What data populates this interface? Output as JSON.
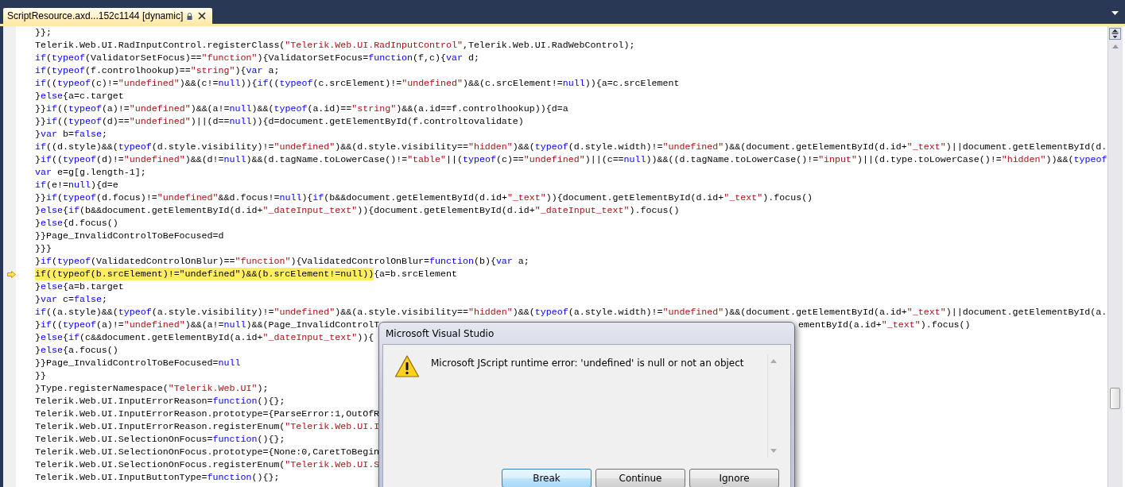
{
  "tab": {
    "label": "ScriptResource.axd...152c1144 [dynamic]",
    "selected": true
  },
  "editor": {
    "lines": [
      {
        "current": false,
        "segs": [
          {
            "kind": "plain",
            "text": "}};"
          }
        ]
      },
      {
        "current": false,
        "segs": [
          {
            "kind": "plain",
            "text": "Telerik.Web.UI.RadInputControl.registerClass("
          },
          {
            "kind": "string",
            "text": "\"Telerik.Web.UI.RadInputControl\""
          },
          {
            "kind": "plain",
            "text": ",Telerik.Web.UI.RadWebControl);"
          }
        ]
      },
      {
        "current": false,
        "segs": [
          {
            "kind": "keyword",
            "text": "if"
          },
          {
            "kind": "plain",
            "text": "("
          },
          {
            "kind": "keyword",
            "text": "typeof"
          },
          {
            "kind": "plain",
            "text": "(ValidatorSetFocus)=="
          },
          {
            "kind": "string",
            "text": "\"function\""
          },
          {
            "kind": "plain",
            "text": "){ValidatorSetFocus="
          },
          {
            "kind": "keyword",
            "text": "function"
          },
          {
            "kind": "plain",
            "text": "(f,c){"
          },
          {
            "kind": "keyword",
            "text": "var"
          },
          {
            "kind": "plain",
            "text": " d;"
          }
        ]
      },
      {
        "current": false,
        "segs": [
          {
            "kind": "keyword",
            "text": "if"
          },
          {
            "kind": "plain",
            "text": "("
          },
          {
            "kind": "keyword",
            "text": "typeof"
          },
          {
            "kind": "plain",
            "text": "(f.controlhookup)=="
          },
          {
            "kind": "string",
            "text": "\"string\""
          },
          {
            "kind": "plain",
            "text": "){"
          },
          {
            "kind": "keyword",
            "text": "var"
          },
          {
            "kind": "plain",
            "text": " a;"
          }
        ]
      },
      {
        "current": false,
        "segs": [
          {
            "kind": "keyword",
            "text": "if"
          },
          {
            "kind": "plain",
            "text": "(("
          },
          {
            "kind": "keyword",
            "text": "typeof"
          },
          {
            "kind": "plain",
            "text": "(c)!="
          },
          {
            "kind": "string",
            "text": "\"undefined\""
          },
          {
            "kind": "plain",
            "text": ")&&(c!="
          },
          {
            "kind": "keyword",
            "text": "null"
          },
          {
            "kind": "plain",
            "text": ")){"
          },
          {
            "kind": "keyword",
            "text": "if"
          },
          {
            "kind": "plain",
            "text": "(("
          },
          {
            "kind": "keyword",
            "text": "typeof"
          },
          {
            "kind": "plain",
            "text": "(c.srcElement)!="
          },
          {
            "kind": "string",
            "text": "\"undefined\""
          },
          {
            "kind": "plain",
            "text": ")&&(c.srcElement!="
          },
          {
            "kind": "keyword",
            "text": "null"
          },
          {
            "kind": "plain",
            "text": ")){a=c.srcElement"
          }
        ]
      },
      {
        "current": false,
        "segs": [
          {
            "kind": "plain",
            "text": "}"
          },
          {
            "kind": "keyword",
            "text": "else"
          },
          {
            "kind": "plain",
            "text": "{a=c.target"
          }
        ]
      },
      {
        "current": false,
        "segs": [
          {
            "kind": "plain",
            "text": "}}"
          },
          {
            "kind": "keyword",
            "text": "if"
          },
          {
            "kind": "plain",
            "text": "(("
          },
          {
            "kind": "keyword",
            "text": "typeof"
          },
          {
            "kind": "plain",
            "text": "(a)!="
          },
          {
            "kind": "string",
            "text": "\"undefined\""
          },
          {
            "kind": "plain",
            "text": ")&&(a!="
          },
          {
            "kind": "keyword",
            "text": "null"
          },
          {
            "kind": "plain",
            "text": ")&&("
          },
          {
            "kind": "keyword",
            "text": "typeof"
          },
          {
            "kind": "plain",
            "text": "(a.id)=="
          },
          {
            "kind": "string",
            "text": "\"string\""
          },
          {
            "kind": "plain",
            "text": ")&&(a.id==f.controlhookup)){d=a"
          }
        ]
      },
      {
        "current": false,
        "segs": [
          {
            "kind": "plain",
            "text": "}}"
          },
          {
            "kind": "keyword",
            "text": "if"
          },
          {
            "kind": "plain",
            "text": "(("
          },
          {
            "kind": "keyword",
            "text": "typeof"
          },
          {
            "kind": "plain",
            "text": "(d)=="
          },
          {
            "kind": "string",
            "text": "\"undefined\""
          },
          {
            "kind": "plain",
            "text": ")||(d=="
          },
          {
            "kind": "keyword",
            "text": "null"
          },
          {
            "kind": "plain",
            "text": ")){d=document.getElementById(f.controltovalidate)"
          }
        ]
      },
      {
        "current": false,
        "segs": [
          {
            "kind": "plain",
            "text": "}"
          },
          {
            "kind": "keyword",
            "text": "var"
          },
          {
            "kind": "plain",
            "text": " b="
          },
          {
            "kind": "keyword",
            "text": "false"
          },
          {
            "kind": "plain",
            "text": ";"
          }
        ]
      },
      {
        "current": false,
        "segs": [
          {
            "kind": "keyword",
            "text": "if"
          },
          {
            "kind": "plain",
            "text": "((d.style)&&("
          },
          {
            "kind": "keyword",
            "text": "typeof"
          },
          {
            "kind": "plain",
            "text": "(d.style.visibility)!="
          },
          {
            "kind": "string",
            "text": "\"undefined\""
          },
          {
            "kind": "plain",
            "text": ")&&(d.style.visibility=="
          },
          {
            "kind": "string",
            "text": "\"hidden\""
          },
          {
            "kind": "plain",
            "text": ")&&("
          },
          {
            "kind": "keyword",
            "text": "typeof"
          },
          {
            "kind": "plain",
            "text": "(d.style.width)!="
          },
          {
            "kind": "string",
            "text": "\"undefined\""
          },
          {
            "kind": "plain",
            "text": ")&&(document.getElementById(d.id+"
          },
          {
            "kind": "string",
            "text": "\"_text\""
          },
          {
            "kind": "plain",
            "text": ")||document.getElementById(d."
          }
        ]
      },
      {
        "current": false,
        "segs": [
          {
            "kind": "plain",
            "text": "}"
          },
          {
            "kind": "keyword",
            "text": "if"
          },
          {
            "kind": "plain",
            "text": "(("
          },
          {
            "kind": "keyword",
            "text": "typeof"
          },
          {
            "kind": "plain",
            "text": "(d)!="
          },
          {
            "kind": "string",
            "text": "\"undefined\""
          },
          {
            "kind": "plain",
            "text": ")&&(d!="
          },
          {
            "kind": "keyword",
            "text": "null"
          },
          {
            "kind": "plain",
            "text": ")&&(d.tagName.toLowerCase()!="
          },
          {
            "kind": "string",
            "text": "\"table\""
          },
          {
            "kind": "plain",
            "text": "||("
          },
          {
            "kind": "keyword",
            "text": "typeof"
          },
          {
            "kind": "plain",
            "text": "(c)=="
          },
          {
            "kind": "string",
            "text": "\"undefined\""
          },
          {
            "kind": "plain",
            "text": ")||(c=="
          },
          {
            "kind": "keyword",
            "text": "null"
          },
          {
            "kind": "plain",
            "text": "))&&((d.tagName.toLowerCase()!="
          },
          {
            "kind": "string",
            "text": "\"input\""
          },
          {
            "kind": "plain",
            "text": ")||(d.type.toLowerCase()!="
          },
          {
            "kind": "string",
            "text": "\"hidden\""
          },
          {
            "kind": "plain",
            "text": "))&&("
          },
          {
            "kind": "keyword",
            "text": "typeof"
          }
        ]
      },
      {
        "current": false,
        "segs": [
          {
            "kind": "keyword",
            "text": "var"
          },
          {
            "kind": "plain",
            "text": " e=g[g.length-1];"
          }
        ]
      },
      {
        "current": false,
        "segs": [
          {
            "kind": "keyword",
            "text": "if"
          },
          {
            "kind": "plain",
            "text": "(e!="
          },
          {
            "kind": "keyword",
            "text": "null"
          },
          {
            "kind": "plain",
            "text": "){d=e"
          }
        ]
      },
      {
        "current": false,
        "segs": [
          {
            "kind": "plain",
            "text": "}}"
          },
          {
            "kind": "keyword",
            "text": "if"
          },
          {
            "kind": "plain",
            "text": "("
          },
          {
            "kind": "keyword",
            "text": "typeof"
          },
          {
            "kind": "plain",
            "text": "(d.focus)!="
          },
          {
            "kind": "string",
            "text": "\"undefined\""
          },
          {
            "kind": "plain",
            "text": "&&d.focus!="
          },
          {
            "kind": "keyword",
            "text": "null"
          },
          {
            "kind": "plain",
            "text": "){"
          },
          {
            "kind": "keyword",
            "text": "if"
          },
          {
            "kind": "plain",
            "text": "(b&&document.getElementById(d.id+"
          },
          {
            "kind": "string",
            "text": "\"_text\""
          },
          {
            "kind": "plain",
            "text": ")){document.getElementById(d.id+"
          },
          {
            "kind": "string",
            "text": "\"_text\""
          },
          {
            "kind": "plain",
            "text": ").focus()"
          }
        ]
      },
      {
        "current": false,
        "segs": [
          {
            "kind": "plain",
            "text": "}"
          },
          {
            "kind": "keyword",
            "text": "else"
          },
          {
            "kind": "plain",
            "text": "{"
          },
          {
            "kind": "keyword",
            "text": "if"
          },
          {
            "kind": "plain",
            "text": "(b&&document.getElementById(d.id+"
          },
          {
            "kind": "string",
            "text": "\"_dateInput_text\""
          },
          {
            "kind": "plain",
            "text": ")){document.getElementById(d.id+"
          },
          {
            "kind": "string",
            "text": "\"_dateInput_text\""
          },
          {
            "kind": "plain",
            "text": ").focus()"
          }
        ]
      },
      {
        "current": false,
        "segs": [
          {
            "kind": "plain",
            "text": "}"
          },
          {
            "kind": "keyword",
            "text": "else"
          },
          {
            "kind": "plain",
            "text": "{d.focus()"
          }
        ]
      },
      {
        "current": false,
        "segs": [
          {
            "kind": "plain",
            "text": "}}Page_InvalidControlToBeFocused=d"
          }
        ]
      },
      {
        "current": false,
        "segs": [
          {
            "kind": "plain",
            "text": "}}}"
          }
        ]
      },
      {
        "current": false,
        "segs": [
          {
            "kind": "plain",
            "text": "}"
          },
          {
            "kind": "keyword",
            "text": "if"
          },
          {
            "kind": "plain",
            "text": "("
          },
          {
            "kind": "keyword",
            "text": "typeof"
          },
          {
            "kind": "plain",
            "text": "(ValidatedControlOnBlur)=="
          },
          {
            "kind": "string",
            "text": "\"function\""
          },
          {
            "kind": "plain",
            "text": "){ValidatedControlOnBlur="
          },
          {
            "kind": "keyword",
            "text": "function"
          },
          {
            "kind": "plain",
            "text": "(b){"
          },
          {
            "kind": "keyword",
            "text": "var"
          },
          {
            "kind": "plain",
            "text": " a;"
          }
        ]
      },
      {
        "current": true,
        "segs": [
          {
            "kind": "plain",
            "text": "if((typeof(b.srcElement)!=\"undefined\")&&(b.srcElement!=null))"
          }
        ],
        "rest": [
          {
            "kind": "plain",
            "text": "{a=b.srcElement"
          }
        ]
      },
      {
        "current": false,
        "segs": [
          {
            "kind": "plain",
            "text": "}"
          },
          {
            "kind": "keyword",
            "text": "else"
          },
          {
            "kind": "plain",
            "text": "{a=b.target"
          }
        ]
      },
      {
        "current": false,
        "segs": [
          {
            "kind": "plain",
            "text": "}"
          },
          {
            "kind": "keyword",
            "text": "var"
          },
          {
            "kind": "plain",
            "text": " c="
          },
          {
            "kind": "keyword",
            "text": "false"
          },
          {
            "kind": "plain",
            "text": ";"
          }
        ]
      },
      {
        "current": false,
        "segs": [
          {
            "kind": "keyword",
            "text": "if"
          },
          {
            "kind": "plain",
            "text": "((a.style)&&("
          },
          {
            "kind": "keyword",
            "text": "typeof"
          },
          {
            "kind": "plain",
            "text": "(a.style.visibility)!="
          },
          {
            "kind": "string",
            "text": "\"undefined\""
          },
          {
            "kind": "plain",
            "text": ")&&(a.style.visibility=="
          },
          {
            "kind": "string",
            "text": "\"hidden\""
          },
          {
            "kind": "plain",
            "text": ")&&("
          },
          {
            "kind": "keyword",
            "text": "typeof"
          },
          {
            "kind": "plain",
            "text": "(a.style.width)!="
          },
          {
            "kind": "string",
            "text": "\"undefined\""
          },
          {
            "kind": "plain",
            "text": ")&&(document.getElementById(a.id+"
          },
          {
            "kind": "string",
            "text": "\"_text\""
          },
          {
            "kind": "plain",
            "text": ")||document.getElementById(a."
          }
        ]
      },
      {
        "current": false,
        "segs": [
          {
            "kind": "plain",
            "text": "}"
          },
          {
            "kind": "keyword",
            "text": "if"
          },
          {
            "kind": "plain",
            "text": "(("
          },
          {
            "kind": "keyword",
            "text": "typeof"
          },
          {
            "kind": "plain",
            "text": "(a)!="
          },
          {
            "kind": "string",
            "text": "\"undefined\""
          },
          {
            "kind": "plain",
            "text": ")&&(a!="
          },
          {
            "kind": "keyword",
            "text": "null"
          },
          {
            "kind": "plain",
            "text": ")&&(Page_InvalidControlT"
          }
        ],
        "tail": [
          {
            "kind": "plain",
            "text": "ementById(a.id+"
          },
          {
            "kind": "string",
            "text": "\"_text\""
          },
          {
            "kind": "plain",
            "text": ").focus()"
          }
        ]
      },
      {
        "current": false,
        "segs": [
          {
            "kind": "plain",
            "text": "}"
          },
          {
            "kind": "keyword",
            "text": "else"
          },
          {
            "kind": "plain",
            "text": "{"
          },
          {
            "kind": "keyword",
            "text": "if"
          },
          {
            "kind": "plain",
            "text": "(c&&document.getElementById(a.id+"
          },
          {
            "kind": "string",
            "text": "\"_dateInput_text\""
          },
          {
            "kind": "plain",
            "text": ")){"
          }
        ]
      },
      {
        "current": false,
        "segs": [
          {
            "kind": "plain",
            "text": "}"
          },
          {
            "kind": "keyword",
            "text": "else"
          },
          {
            "kind": "plain",
            "text": "{a.focus()"
          }
        ]
      },
      {
        "current": false,
        "segs": [
          {
            "kind": "plain",
            "text": "}}Page_InvalidControlToBeFocused="
          },
          {
            "kind": "keyword",
            "text": "null"
          }
        ]
      },
      {
        "current": false,
        "segs": [
          {
            "kind": "plain",
            "text": "}}"
          }
        ]
      },
      {
        "current": false,
        "segs": [
          {
            "kind": "plain",
            "text": "}Type.registerNamespace("
          },
          {
            "kind": "string",
            "text": "\"Telerik.Web.UI\""
          },
          {
            "kind": "plain",
            "text": ");"
          }
        ]
      },
      {
        "current": false,
        "segs": [
          {
            "kind": "plain",
            "text": "Telerik.Web.UI.InputErrorReason="
          },
          {
            "kind": "keyword",
            "text": "function"
          },
          {
            "kind": "plain",
            "text": "(){};"
          }
        ]
      },
      {
        "current": false,
        "segs": [
          {
            "kind": "plain",
            "text": "Telerik.Web.UI.InputErrorReason.prototype={ParseError:1,OutOfR"
          }
        ]
      },
      {
        "current": false,
        "segs": [
          {
            "kind": "plain",
            "text": "Telerik.Web.UI.InputErrorReason.registerEnum("
          },
          {
            "kind": "string",
            "text": "\"Telerik.Web.UI.I"
          }
        ]
      },
      {
        "current": false,
        "segs": [
          {
            "kind": "plain",
            "text": "Telerik.Web.UI.SelectionOnFocus="
          },
          {
            "kind": "keyword",
            "text": "function"
          },
          {
            "kind": "plain",
            "text": "(){};"
          }
        ]
      },
      {
        "current": false,
        "segs": [
          {
            "kind": "plain",
            "text": "Telerik.Web.UI.SelectionOnFocus.prototype={None:0,CaretToBegin"
          }
        ]
      },
      {
        "current": false,
        "segs": [
          {
            "kind": "plain",
            "text": "Telerik.Web.UI.SelectionOnFocus.registerEnum("
          },
          {
            "kind": "string",
            "text": "\"Telerik.Web.UI.S"
          }
        ]
      },
      {
        "current": false,
        "segs": [
          {
            "kind": "plain",
            "text": "Telerik.Web.UI.InputButtonType="
          },
          {
            "kind": "keyword",
            "text": "function"
          },
          {
            "kind": "plain",
            "text": "(){};"
          }
        ]
      }
    ]
  },
  "dialog": {
    "title": "Microsoft Visual Studio",
    "message": "Microsoft JScript runtime error: 'undefined' is null or not an object",
    "buttons": [
      {
        "label": "Break",
        "default": true
      },
      {
        "label": "Continue",
        "default": false
      },
      {
        "label": "Ignore",
        "default": false
      }
    ]
  }
}
